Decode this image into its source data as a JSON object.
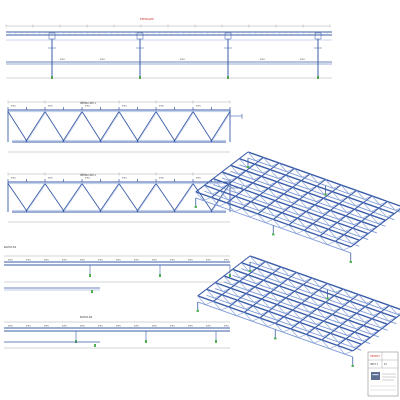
{
  "drawing": {
    "top_note": "ЕЛЕВАЦИЯ",
    "truss1_note": "ФЕРМА ФМ 1",
    "truss2_note": "ФЕРМА ФМ 2",
    "beam1_note": "БАЛКА Б1",
    "beam2_note": "БАЛКА Б2",
    "member_tag": "ФМ1",
    "colors": {
      "member": "#3a5ca8",
      "member_light": "#7f9bd6",
      "iso_fill": "#c9d6ee",
      "dim": "#777777",
      "support": "#4caf50",
      "accent": "#d23030"
    }
  },
  "title_block": {
    "project": "ПРОЕКТ",
    "sheet": "ЛИСТ 1",
    "rev": "Р1"
  }
}
